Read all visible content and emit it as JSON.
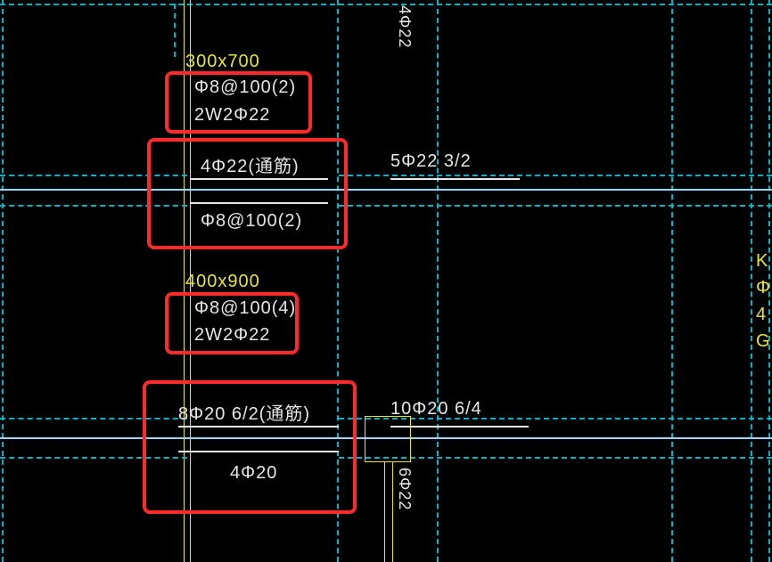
{
  "beam1": {
    "size": "300x700",
    "stirrup_top": "Φ8@100(2)",
    "waist": "2W2Φ22",
    "top_bar": "4Φ22(通筋)",
    "right_top_bar": "5Φ22 3/2",
    "stirrup_bot": "Φ8@100(2)"
  },
  "beam2": {
    "size": "400x900",
    "stirrup_top": "Φ8@100(4)",
    "waist": "2W2Φ22",
    "top_bar": "8Φ20 6/2(通筋)",
    "right_top_bar": "10Φ20 6/4",
    "bot_bar": "4Φ20"
  },
  "col_labels": {
    "top_vert": "4Φ22",
    "bot_vert": "6Φ22"
  },
  "side": {
    "l1": "K",
    "l2": "Φ",
    "l3": "4",
    "l4": "G"
  }
}
